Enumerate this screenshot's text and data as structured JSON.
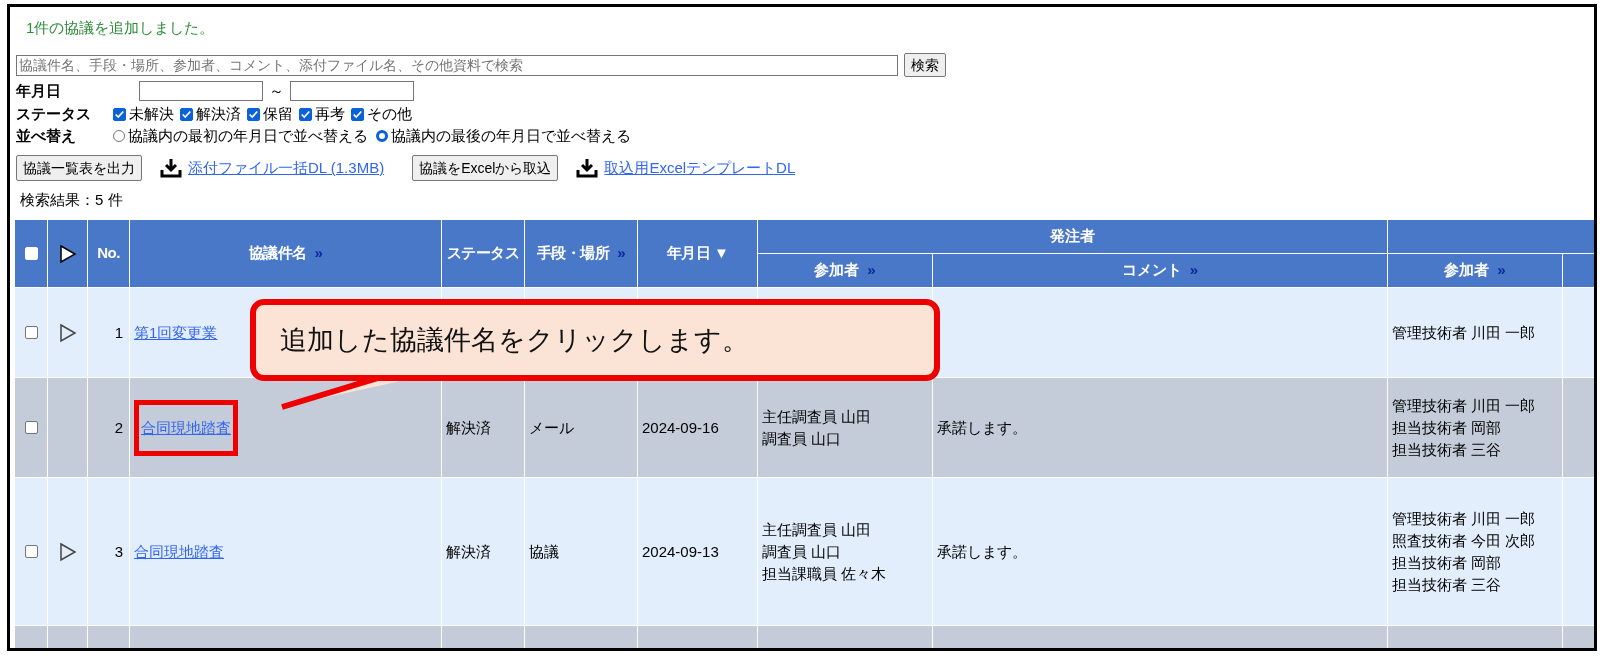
{
  "message": "1件の協議を追加しました。",
  "search": {
    "placeholder": "協議件名、手段・場所、参加者、コメント、添付ファイル名、その他資料で検索",
    "button": "検索"
  },
  "filters": {
    "date": {
      "label": "年月日",
      "separator": "～"
    },
    "status": {
      "label": "ステータス",
      "options": [
        {
          "label": "未解決",
          "checked": true
        },
        {
          "label": "解決済",
          "checked": true
        },
        {
          "label": "保留",
          "checked": true
        },
        {
          "label": "再考",
          "checked": true
        },
        {
          "label": "その他",
          "checked": true
        }
      ]
    },
    "sort": {
      "label": "並べ替え",
      "options": [
        {
          "label": "協議内の最初の年月日で並べ替える",
          "selected": false
        },
        {
          "label": "協議内の最後の年月日で並べ替える",
          "selected": true
        }
      ]
    }
  },
  "actions": [
    {
      "kind": "button",
      "label": "協議一覧表を出力"
    },
    {
      "kind": "download",
      "label": "添付ファイル一括DL (1.3MB)"
    },
    {
      "kind": "button",
      "label": "協議をExcelから取込"
    },
    {
      "kind": "download",
      "label": "取込用ExcelテンプレートDL"
    }
  ],
  "result_count": "検索結果：5 件",
  "table": {
    "columns": [
      {
        "label": "No."
      },
      {
        "label": "協議件名",
        "marker": "»"
      },
      {
        "label": "ステータス"
      },
      {
        "label": "手段・場所",
        "marker": "»"
      },
      {
        "label": "年月日",
        "marker": "▼"
      }
    ],
    "groups": [
      {
        "label": "発注者",
        "columns": [
          {
            "label": "参加者",
            "marker": "»"
          },
          {
            "label": "コメント",
            "marker": "»"
          }
        ]
      },
      {
        "columns": [
          {
            "label": "参加者",
            "marker": "»"
          }
        ]
      }
    ],
    "rows": [
      {
        "no": "1",
        "title": "第1回変更業",
        "checked": false,
        "expandable": true,
        "highlighted": false,
        "contractor_participants": [
          "管理技術者 川田 一郎"
        ]
      },
      {
        "no": "2",
        "title": "合同現地踏査",
        "checked": false,
        "expandable": false,
        "highlighted": true,
        "status": "解決済",
        "method": "メール",
        "date": "2024-09-16",
        "participants": [
          "主任調査員 山田",
          "調査員 山口"
        ],
        "comment": "承諾します。",
        "contractor_participants": [
          "管理技術者 川田 一郎",
          "担当技術者 岡部",
          "担当技術者 三谷"
        ]
      },
      {
        "no": "3",
        "title": "合同現地踏査",
        "checked": false,
        "expandable": true,
        "highlighted": false,
        "status": "解決済",
        "method": "協議",
        "date": "2024-09-13",
        "participants": [
          "主任調査員 山田",
          "調査員 山口",
          "担当課職員 佐々木"
        ],
        "comment": "承諾します。",
        "contractor_participants": [
          "管理技術者 川田 一郎",
          "照査技術者 今田 次郎",
          "担当技術者 岡部",
          "担当技術者 三谷"
        ]
      },
      {}
    ],
    "select_all": {
      "checked": false
    }
  },
  "callout": "追加した協議件名をクリックします。"
}
